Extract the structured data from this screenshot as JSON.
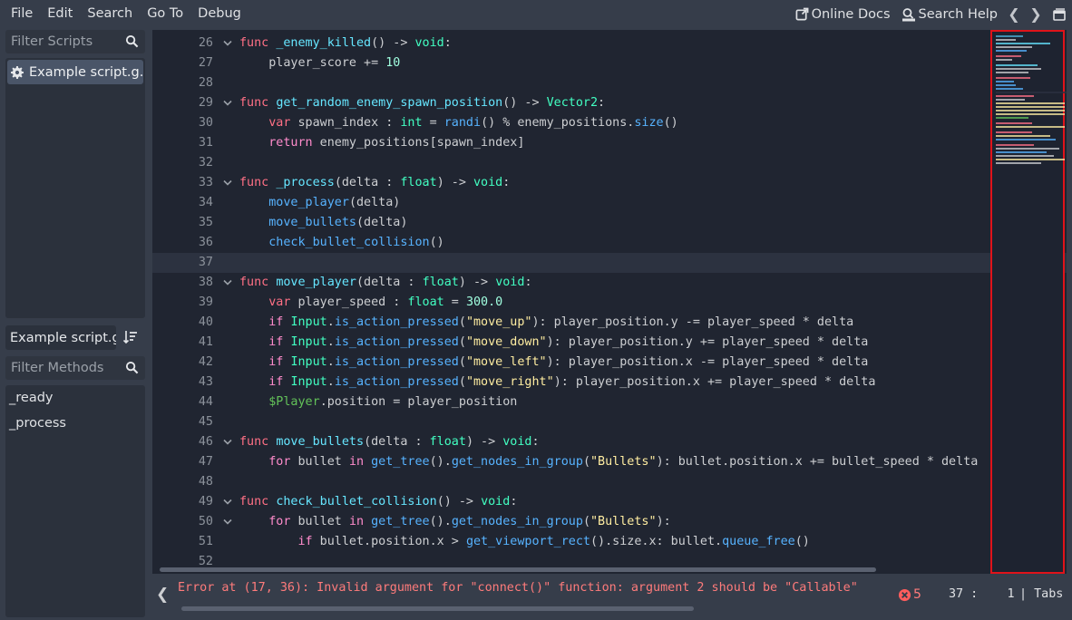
{
  "menu": [
    "File",
    "Edit",
    "Search",
    "Go To",
    "Debug"
  ],
  "topright": {
    "online_docs": "Online Docs",
    "search_help": "Search Help"
  },
  "left": {
    "filter_scripts": "Filter Scripts",
    "script_item": "Example script.g...",
    "script_title": "Example script.gd",
    "filter_methods": "Filter Methods",
    "methods": [
      "_ready",
      "_process"
    ]
  },
  "code_lines": [
    {
      "n": "26",
      "fold": true
    },
    {
      "n": "27"
    },
    {
      "n": "28"
    },
    {
      "n": "29",
      "fold": true
    },
    {
      "n": "30"
    },
    {
      "n": "31"
    },
    {
      "n": "32"
    },
    {
      "n": "33",
      "fold": true
    },
    {
      "n": "34"
    },
    {
      "n": "35"
    },
    {
      "n": "36"
    },
    {
      "n": "37",
      "current": true
    },
    {
      "n": "38",
      "fold": true
    },
    {
      "n": "39"
    },
    {
      "n": "40"
    },
    {
      "n": "41"
    },
    {
      "n": "42"
    },
    {
      "n": "43"
    },
    {
      "n": "44"
    },
    {
      "n": "45"
    },
    {
      "n": "46",
      "fold": true
    },
    {
      "n": "47"
    },
    {
      "n": "48"
    },
    {
      "n": "49",
      "fold": true
    },
    {
      "n": "50",
      "fold": true
    },
    {
      "n": "51"
    },
    {
      "n": "52"
    }
  ],
  "code": {
    "l26": [
      "func",
      " ",
      "_enemy_killed",
      "() -> ",
      "void",
      ":"
    ],
    "l27": [
      "    player_score += ",
      "10"
    ],
    "l29": [
      "func",
      " ",
      "get_random_enemy_spawn_position",
      "() -> ",
      "Vector2",
      ":"
    ],
    "l30": [
      "    ",
      "var",
      " spawn_index : ",
      "int",
      " = ",
      "randi",
      "() % enemy_positions.",
      "size",
      "()"
    ],
    "l31": [
      "    ",
      "return",
      " enemy_positions[spawn_index]"
    ],
    "l33": [
      "func",
      " ",
      "_process",
      "(delta : ",
      "float",
      ") -> ",
      "void",
      ":"
    ],
    "l34": [
      "    ",
      "move_player",
      "(delta)"
    ],
    "l35": [
      "    ",
      "move_bullets",
      "(delta)"
    ],
    "l36": [
      "    ",
      "check_bullet_collision",
      "()"
    ],
    "l38": [
      "func",
      " ",
      "move_player",
      "(delta : ",
      "float",
      ") -> ",
      "void",
      ":"
    ],
    "l39": [
      "    ",
      "var",
      " player_speed : ",
      "float",
      " = ",
      "300.0"
    ],
    "l40": [
      "    ",
      "if",
      " ",
      "Input",
      ".",
      "is_action_pressed",
      "(",
      "\"move_up\"",
      "): player_position.y -= player_speed * delta"
    ],
    "l41": [
      "    ",
      "if",
      " ",
      "Input",
      ".",
      "is_action_pressed",
      "(",
      "\"move_down\"",
      "): player_position.y += player_speed * delta"
    ],
    "l42": [
      "    ",
      "if",
      " ",
      "Input",
      ".",
      "is_action_pressed",
      "(",
      "\"move_left\"",
      "): player_position.x -= player_speed * delta"
    ],
    "l43": [
      "    ",
      "if",
      " ",
      "Input",
      ".",
      "is_action_pressed",
      "(",
      "\"move_right\"",
      "): player_position.x += player_speed * delta"
    ],
    "l44": [
      "    ",
      "$Player",
      ".position = player_position"
    ],
    "l46": [
      "func",
      " ",
      "move_bullets",
      "(delta : ",
      "float",
      ") -> ",
      "void",
      ":"
    ],
    "l47": [
      "    ",
      "for",
      " bullet ",
      "in",
      " ",
      "get_tree",
      "().",
      "get_nodes_in_group",
      "(",
      "\"Bullets\"",
      "): bullet.position.x += bullet_speed * delta"
    ],
    "l49": [
      "func",
      " ",
      "check_bullet_collision",
      "() -> ",
      "void",
      ":"
    ],
    "l50": [
      "    ",
      "for",
      " bullet ",
      "in",
      " ",
      "get_tree",
      "().",
      "get_nodes_in_group",
      "(",
      "\"Bullets\"",
      "):"
    ],
    "l51": [
      "        ",
      "if",
      " bullet.position.x > ",
      "get_viewport_rect",
      "().size.x: bullet.",
      "queue_free",
      "()"
    ]
  },
  "status": {
    "error": "Error at (17, 36): Invalid argument for \"connect()\" function: argument 2 should be \"Callable\"",
    "error_count": "5",
    "cursor": "37 :    1",
    "indent": "| Tabs"
  },
  "colors": {
    "keyword": "#ff7085",
    "control": "#ff8ccc",
    "function": "#57b3ff",
    "type": "#42ffc2",
    "number": "#a1ffe0",
    "string": "#ffeda1",
    "node_path": "#63c259",
    "minimap_highlight": "#e0131a"
  }
}
